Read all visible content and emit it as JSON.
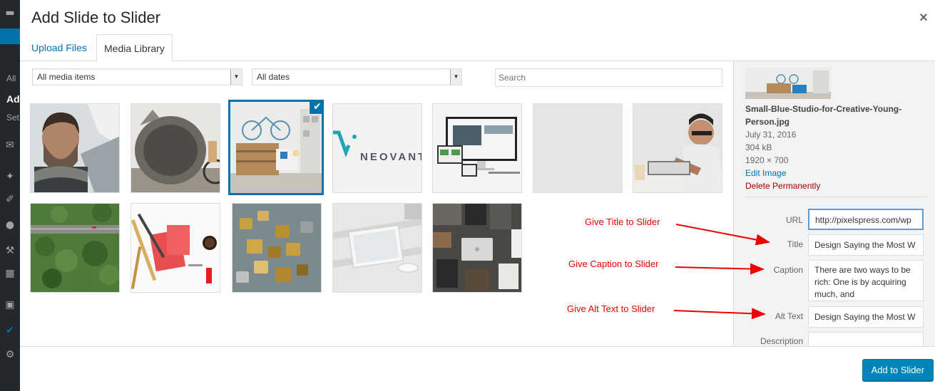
{
  "background_admin": {
    "menu_text": [
      "All",
      "Ad",
      "Set"
    ]
  },
  "modal": {
    "title": "Add Slide to Slider",
    "close_label": "×"
  },
  "tabs": {
    "upload": "Upload Files",
    "library": "Media Library"
  },
  "filters": {
    "media_type": "All media items",
    "dates": "All dates",
    "search_placeholder": "Search"
  },
  "thumbnails": [
    {
      "name": "man-with-beard",
      "selected": false
    },
    {
      "name": "concrete-tube-cyclist",
      "selected": false
    },
    {
      "name": "blue-studio-room",
      "selected": true
    },
    {
      "name": "neovant-logo",
      "selected": false,
      "text": "NEOVANT"
    },
    {
      "name": "devices-mockup",
      "selected": false
    },
    {
      "name": "blank-gray",
      "selected": false
    },
    {
      "name": "man-at-laptop",
      "selected": false
    },
    {
      "name": "forest-road-aerial",
      "selected": false
    },
    {
      "name": "desk-stationery",
      "selected": false
    },
    {
      "name": "love-locks",
      "selected": false
    },
    {
      "name": "tablet-on-desk",
      "selected": false
    },
    {
      "name": "flatlay-laptop",
      "selected": false
    }
  ],
  "details": {
    "filename": "Small-Blue-Studio-for-Creative-Young-Person.jpg",
    "date": "July 31, 2016",
    "size": "304 kB",
    "dimensions": "1920 × 700",
    "edit_link": "Edit Image",
    "delete_link": "Delete Permanently",
    "fields": {
      "url_label": "URL",
      "url_value": "http://pixelspress.com/wp",
      "title_label": "Title",
      "title_value": "Design Saying the Most W",
      "caption_label": "Caption",
      "caption_value": "There are two ways to be rich: One is by acquiring much, and",
      "alt_label": "Alt Text",
      "alt_value": "Design Saying the Most W",
      "description_label": "Description"
    }
  },
  "annotations": {
    "title": "Give Title to Slider",
    "caption": "Give Caption to Slider",
    "alt": "Give Alt Text to Slider",
    "color": "#e00000"
  },
  "footer": {
    "add_button": "Add to Slider"
  }
}
